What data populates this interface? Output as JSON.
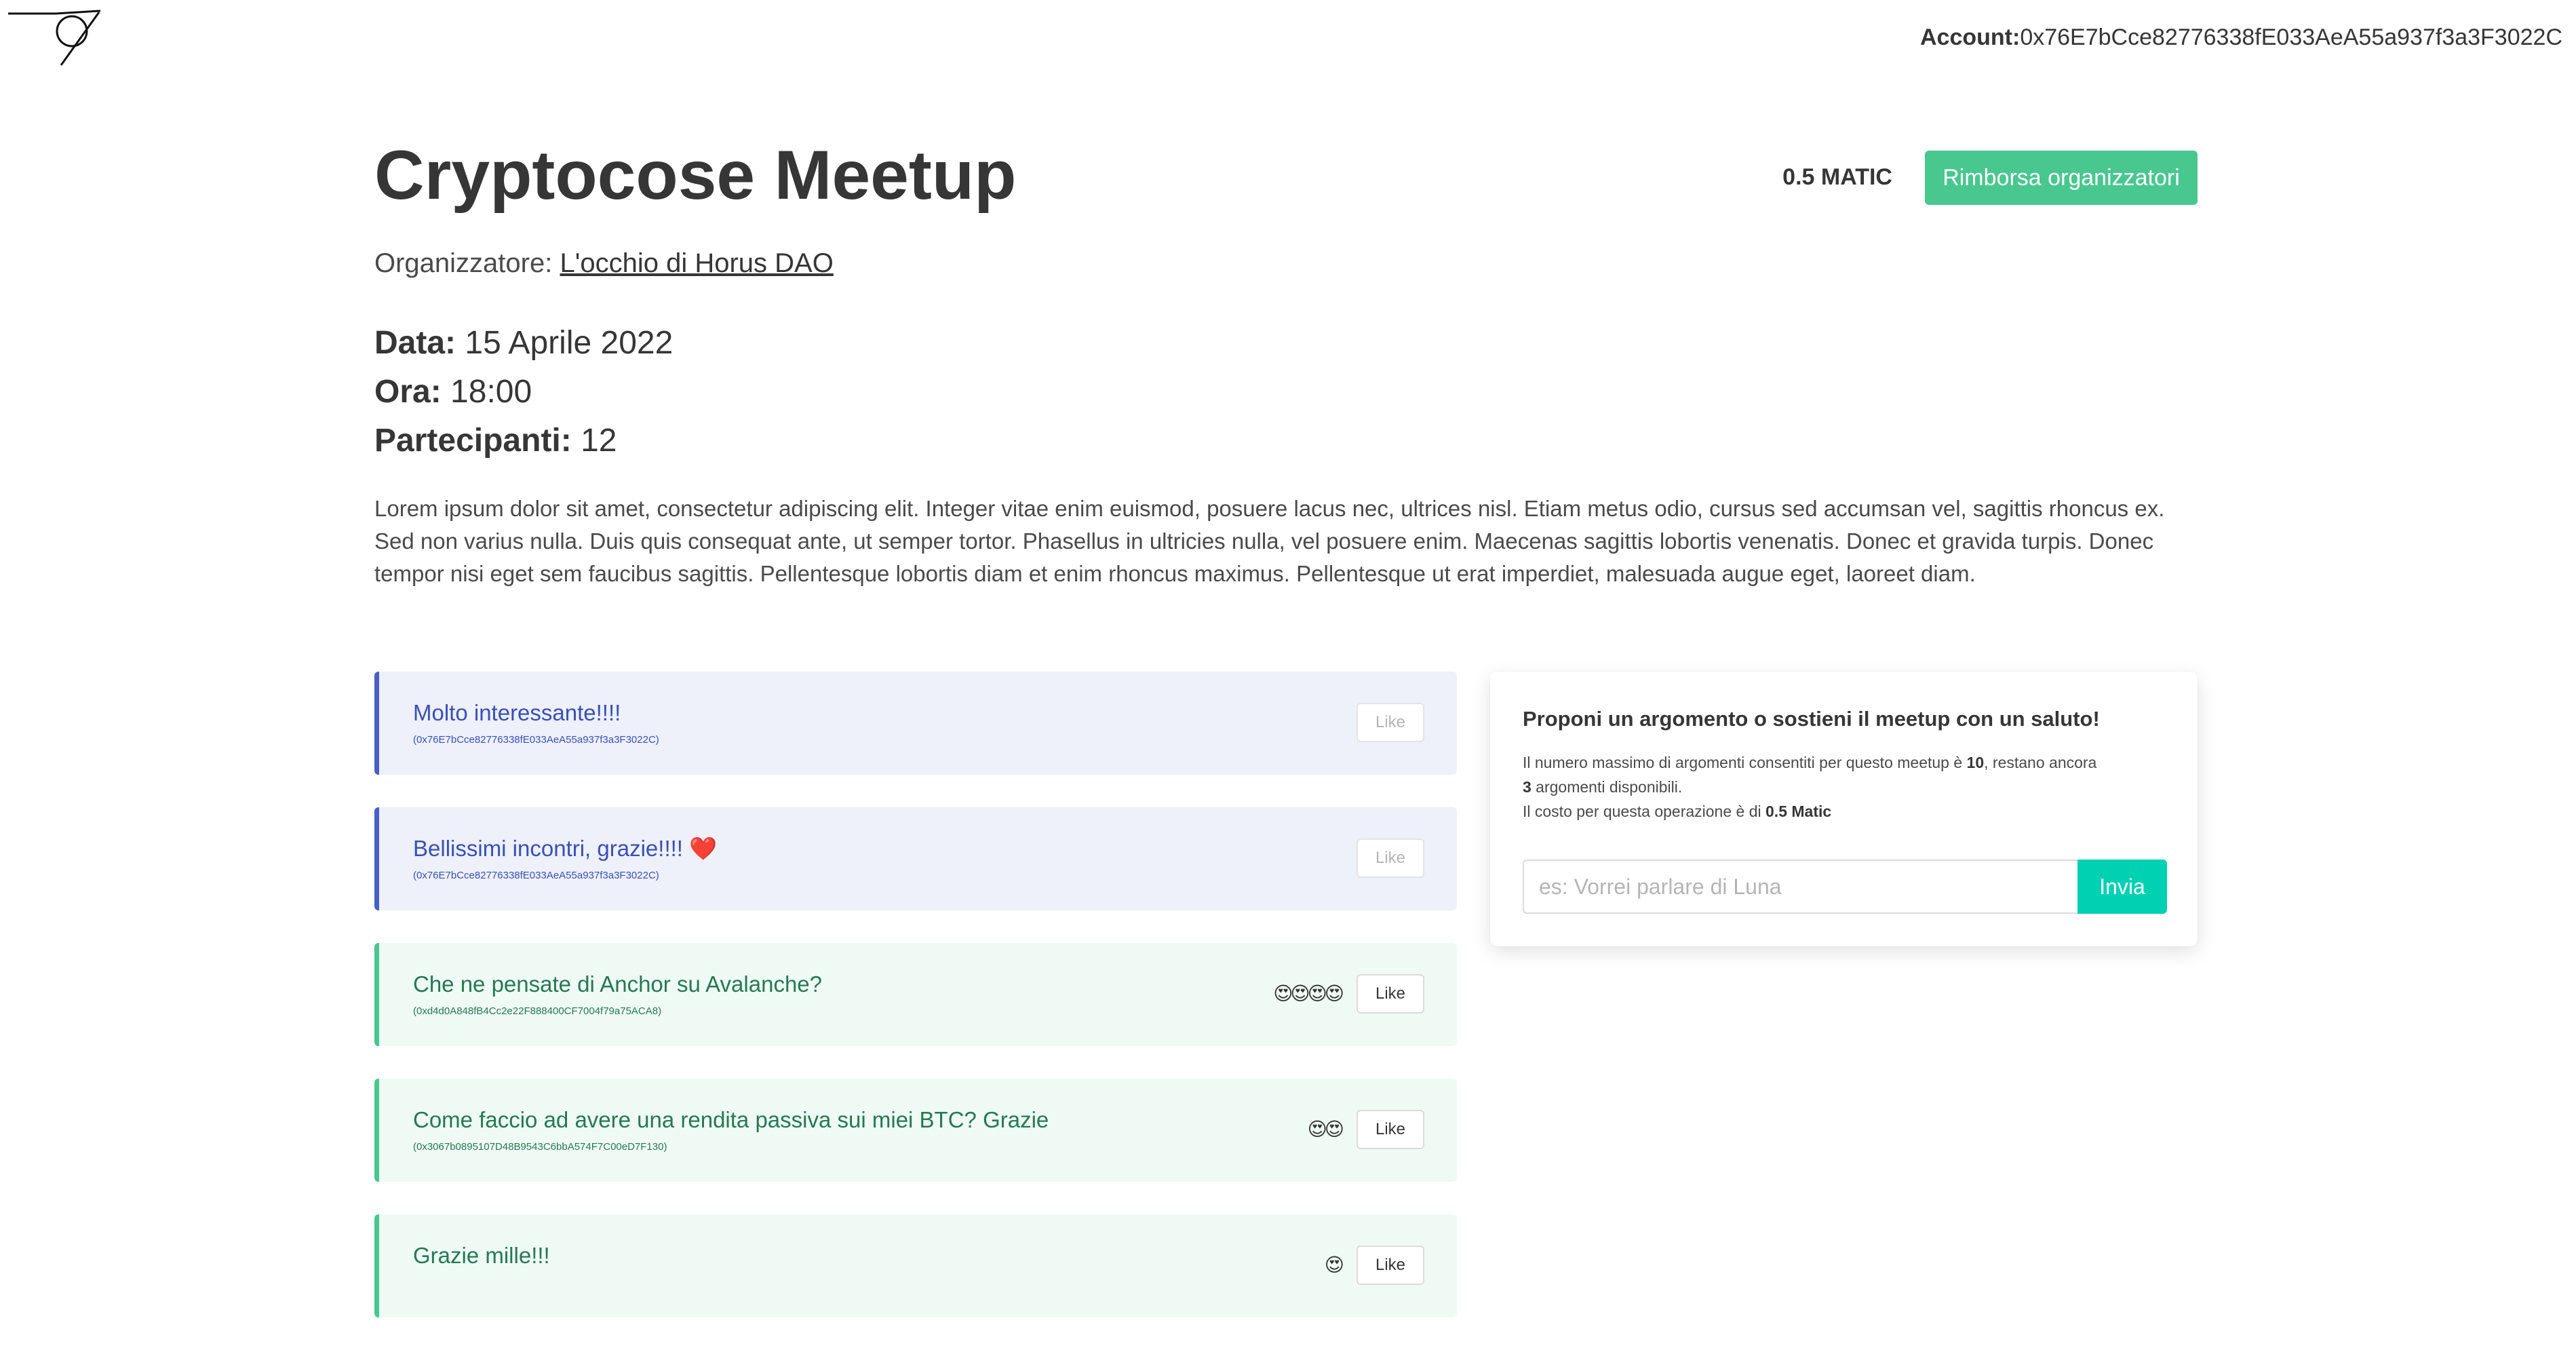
{
  "header": {
    "account_label": "Account:",
    "account_address": "0x76E7bCce82776338fE033AeA55a937f3a3F3022C"
  },
  "meetup": {
    "title": "Cryptocose Meetup",
    "price": "0.5 MATIC",
    "refund_button": "Rimborsa organizzatori",
    "organizer_label": "Organizzatore:",
    "organizer_name": "L'occhio di Horus DAO",
    "date_label": "Data:",
    "date_value": "15 Aprile 2022",
    "time_label": "Ora:",
    "time_value": "18:00",
    "participants_label": "Partecipanti:",
    "participants_value": "12",
    "description": "Lorem ipsum dolor sit amet, consectetur adipiscing elit. Integer vitae enim euismod, posuere lacus nec, ultrices nisl. Etiam metus odio, cursus sed accumsan vel, sagittis rhoncus ex. Sed non varius nulla. Duis quis consequat ante, ut semper tortor. Phasellus in ultricies nulla, vel posuere enim. Maecenas sagittis lobortis venenatis. Donec et gravida turpis. Donec tempor nisi eget sem faucibus sagittis. Pellentesque lobortis diam et enim rhoncus maximus. Pellentesque ut erat imperdiet, malesuada augue eget, laoreet diam."
  },
  "messages": [
    {
      "text": "Molto interessante!!!!",
      "address": "(0x76E7bCce82776338fE033AeA55a937f3a3F3022C)",
      "reactions": "",
      "like_label": "Like",
      "style": "blue",
      "like_disabled": true
    },
    {
      "text": "Bellissimi incontri, grazie!!!! ❤️",
      "address": "(0x76E7bCce82776338fE033AeA55a937f3a3F3022C)",
      "reactions": "",
      "like_label": "Like",
      "style": "blue",
      "like_disabled": true
    },
    {
      "text": "Che ne pensate di Anchor su Avalanche?",
      "address": "(0xd4d0A848fB4Cc2e22F888400CF7004f79a75ACA8)",
      "reactions": "😍😍😍😍",
      "like_label": "Like",
      "style": "green",
      "like_disabled": false
    },
    {
      "text": "Come faccio ad avere una rendita passiva sui miei BTC? Grazie",
      "address": "(0x3067b0895107D48B9543C6bbA574F7C00eD7F130)",
      "reactions": "😍😍",
      "like_label": "Like",
      "style": "green",
      "like_disabled": false
    },
    {
      "text": "Grazie mille!!!",
      "address": "",
      "reactions": "😍",
      "like_label": "Like",
      "style": "green",
      "like_disabled": false
    }
  ],
  "propose": {
    "title": "Proponi un argomento o sostieni il meetup con un saluto!",
    "info_prefix": "Il numero massimo di argomenti consentiti per questo meetup è ",
    "max_topics": "10",
    "info_middle": ", restano ancora ",
    "remaining_topics": "3",
    "info_suffix": " argomenti disponibili.",
    "cost_prefix": "Il costo per questa operazione è di ",
    "cost_value": "0.5 Matic",
    "input_placeholder": "es: Vorrei parlare di Luna",
    "input_value": "",
    "send_button": "Invia"
  },
  "colors": {
    "primary_green": "#48c78e",
    "turquoise": "#00d1b2",
    "info_blue": "#485fc7",
    "blue_bg": "#eef0fa",
    "green_bg": "#effaf5"
  }
}
